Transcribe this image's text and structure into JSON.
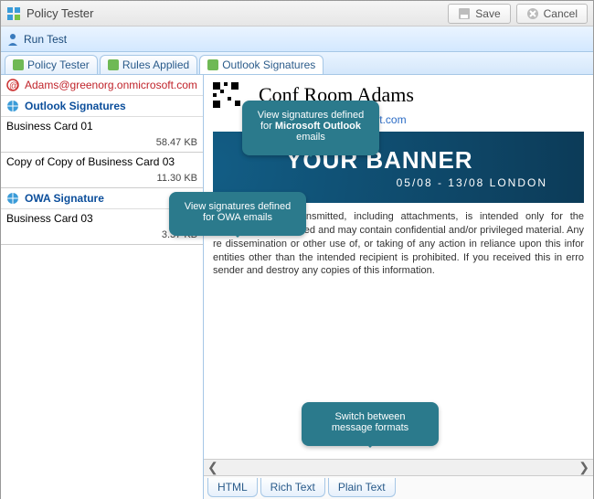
{
  "window": {
    "title": "Policy Tester"
  },
  "titlebar_buttons": {
    "save": "Save",
    "cancel": "Cancel"
  },
  "toolbar": {
    "run_test": "Run Test"
  },
  "tabs": {
    "policy_tester": "Policy Tester",
    "rules_applied": "Rules Applied",
    "outlook_signatures": "Outlook Signatures"
  },
  "sidebar": {
    "email": "Adams@greenorg.onmicrosoft.com",
    "section_outlook": "Outlook Signatures",
    "items_outlook": [
      {
        "name": "Business Card 01",
        "size": "58.47 KB"
      },
      {
        "name": "Copy of Copy of Business Card 03",
        "size": "11.30 KB"
      }
    ],
    "section_owa": "OWA Signature",
    "items_owa": [
      {
        "name": "Business Card 03",
        "size": "3.37 KB"
      }
    ]
  },
  "preview": {
    "room_title": "Conf Room Adams",
    "email_label": "@greenorg.onmicrosoft.com",
    "banner_line1": "YOUR BANNER",
    "banner_line2": "05/08 - 13/08   LONDON",
    "disclaimer": "The information transmitted, including attachments, is intended only for the person(s) is addressed and may contain confidential and/or privileged material. Any re dissemination or other use of, or taking of any action in reliance upon this infor entities other than the intended recipient is prohibited. If you received this in erro sender and destroy any copies of this information."
  },
  "format_tabs": {
    "html": "HTML",
    "rich": "Rich Text",
    "plain": "Plain Text"
  },
  "callouts": {
    "c1a": "View signatures defined",
    "c1b": "for ",
    "c1c": "Microsoft Outlook",
    "c1d": " emails",
    "c2": "View signatures defined for OWA emails",
    "c3": "Switch between message formats"
  }
}
